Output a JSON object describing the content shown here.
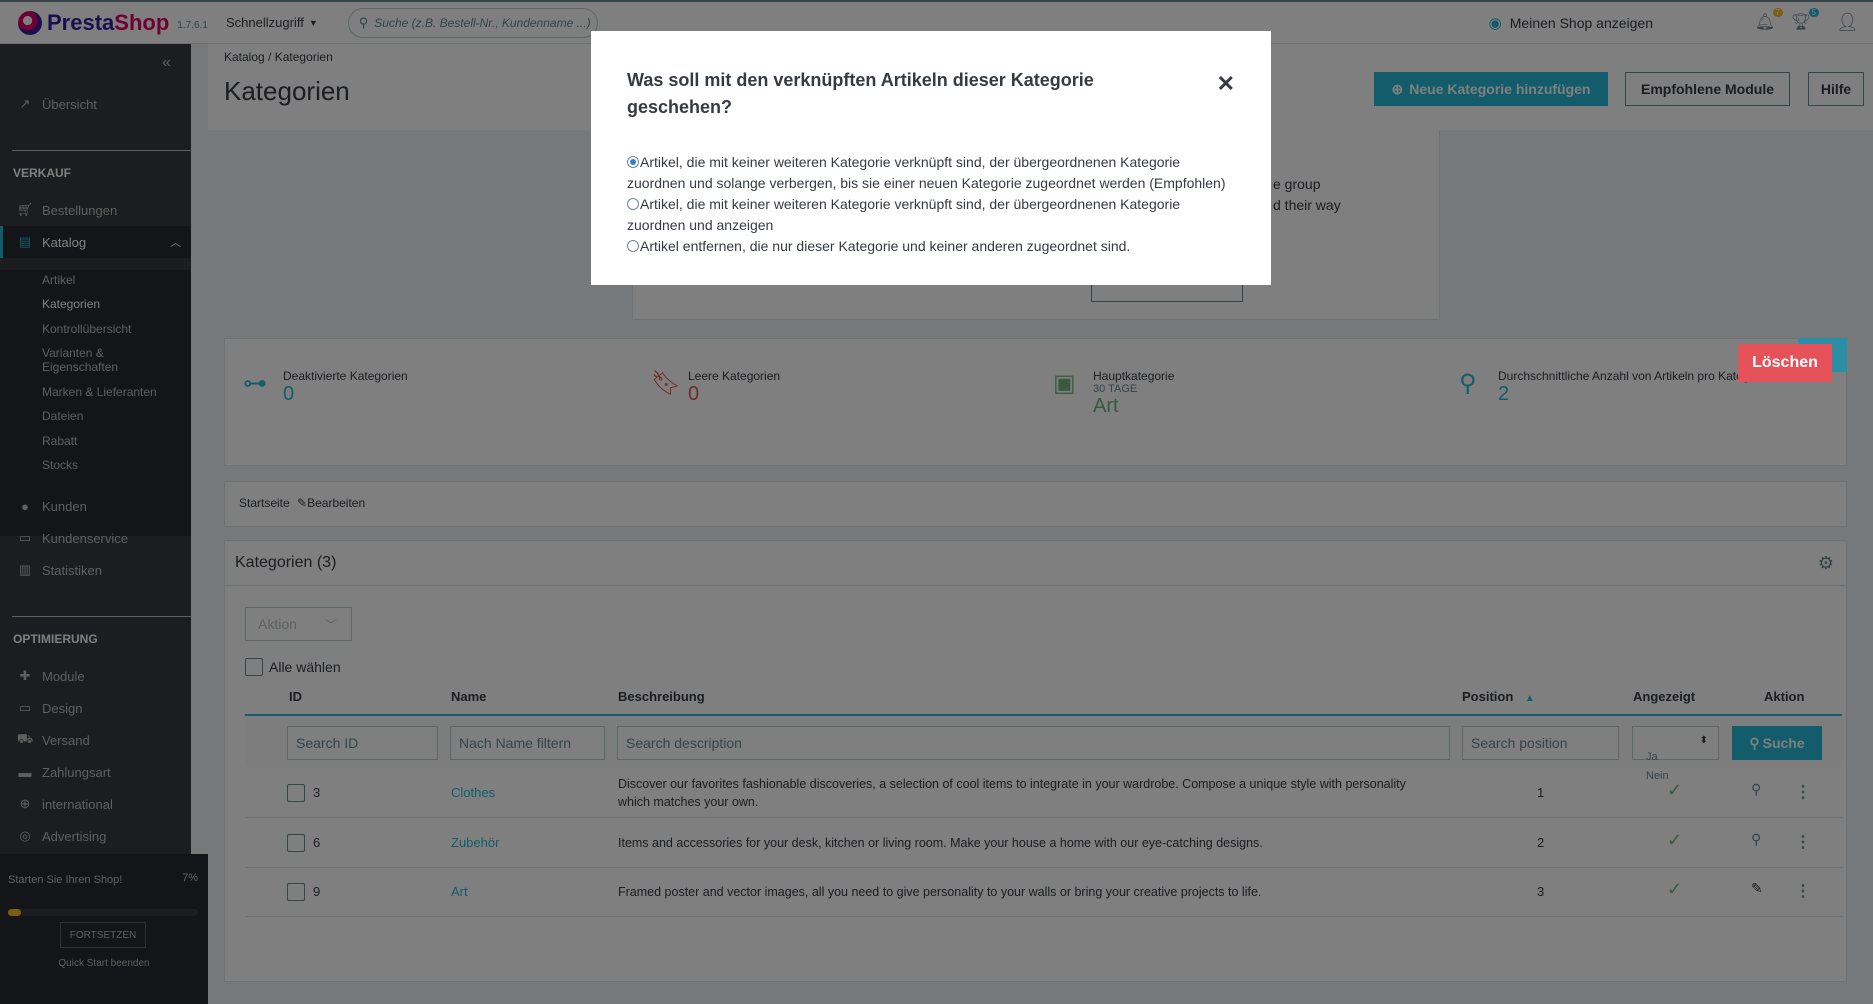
{
  "header": {
    "logo_presta": "Presta",
    "logo_shop": "Shop",
    "version": "1.7.6.1",
    "quick_access": "Schnellzugriff",
    "search_placeholder": "Suche (z.B. Bestell-Nr., Kundenname ...)",
    "view_shop": "Meinen Shop anzeigen",
    "notif_orders_count": "7",
    "notif_customers_count": "5"
  },
  "sidebar": {
    "overview": "Übersicht",
    "section_sell": "VERKAUF",
    "orders": "Bestellungen",
    "catalog": "Katalog",
    "catalog_sub": [
      "Artikel",
      "Kategorien",
      "Kontrollübersicht",
      "Varianten & Eigenschaften",
      "Marken & Lieferanten",
      "Dateien",
      "Rabatt",
      "Stocks"
    ],
    "customers": "Kunden",
    "customer_service": "Kundenservice",
    "stats": "Statistiken",
    "section_improve": "OPTIMIERUNG",
    "modules": "Module",
    "design": "Design",
    "shipping": "Versand",
    "payment": "Zahlungsart",
    "international": "international",
    "advertising": "Advertising",
    "onboarding_text": "Starten Sie Ihren Shop!",
    "onboarding_pct": "7%",
    "onboarding_progress": 0.07,
    "onboarding_continue": "FORTSETZEN",
    "onboarding_end": "Quick Start beenden"
  },
  "page": {
    "breadcrumb_1": "Katalog",
    "breadcrumb_sep": "/",
    "breadcrumb_2": "Kategorien",
    "title": "Kategorien",
    "btn_add": "Neue Kategorie hinzufügen",
    "btn_modules": "Empfohlene Module",
    "btn_help": "Hilfe"
  },
  "helper_fragments": {
    "line1": "e group",
    "line2": "d their way"
  },
  "kpis": [
    {
      "label": "Deaktivierte Kategorien",
      "sub": "",
      "value": "0",
      "color": "#25b9d7"
    },
    {
      "label": "Leere Kategorien",
      "sub": "",
      "value": "0",
      "color": "#e5525a"
    },
    {
      "label": "Hauptkategorie",
      "sub": "30 TAGE",
      "value": "Art",
      "color": "#70b580"
    },
    {
      "label": "Durchschnittliche Anzahl von Artikeln pro Kategorie",
      "sub": "",
      "value": "2",
      "color": "#25b9d7"
    }
  ],
  "category_breadcrumb": {
    "home": "Startseite",
    "edit": "Bearbeiten"
  },
  "table": {
    "title": "Kategorien (3)",
    "bulk_action": "Aktion",
    "select_all": "Alle wählen",
    "columns": {
      "id": "ID",
      "name": "Name",
      "description": "Beschreibung",
      "position": "Position",
      "displayed": "Angezeigt",
      "action": "Aktion"
    },
    "filters": {
      "id": "Search ID",
      "name": "Nach Name filtern",
      "description": "Search description",
      "position": "Search position",
      "displayed_options": [
        "Ja",
        "Nein"
      ],
      "search_button": "Suche"
    },
    "rows": [
      {
        "id": "3",
        "name": "Clothes",
        "description": "Discover our favorites fashionable discoveries, a selection of cool items to integrate in your wardrobe. Compose a unique style with personality which matches your own.",
        "position": "1",
        "displayed": true
      },
      {
        "id": "6",
        "name": "Zubehör",
        "description": "Items and accessories for your desk, kitchen or living room. Make your house a home with our eye-catching designs.",
        "position": "2",
        "displayed": true
      },
      {
        "id": "9",
        "name": "Art",
        "description": "Framed poster and vector images, all you need to give personality to your walls or bring your creative projects to life.",
        "position": "3",
        "displayed": true
      }
    ]
  },
  "modal": {
    "title": "Was soll mit den verknüpften Artikeln dieser Kategorie geschehen?",
    "option_1": "Artikel, die mit keiner weiteren Kategorie verknüpft sind, der übergeordnenen Kategorie zuordnen und solange verbergen, bis sie einer neuen Kategorie zugeordnet werden (Empfohlen)",
    "option_2": "Artikel, die mit keiner weiteren Kategorie verknüpft sind, der übergeordnenen Kategorie zuordnen und anzeigen",
    "option_3": "Artikel entfernen, die nur dieser Kategorie und keiner anderen zugeordnet sind.",
    "selected_option": 1
  },
  "delete_button": "Löschen"
}
